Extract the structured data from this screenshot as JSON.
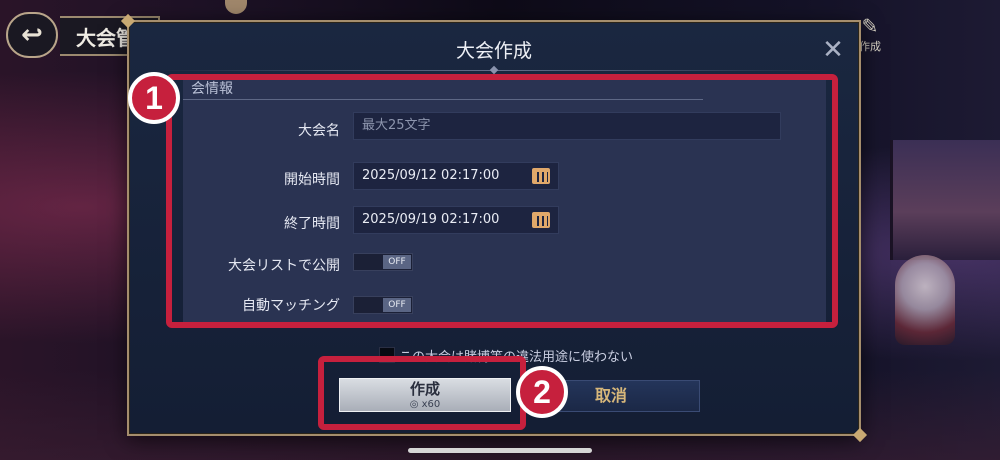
{
  "header": {
    "back_icon": "back-arrow-icon",
    "title": "大会管",
    "create_icon": "create-icon",
    "create_label": "作成"
  },
  "modal": {
    "title": "大会作成",
    "close_icon": "close-icon",
    "section_label": "会情報",
    "fields": {
      "name": {
        "label": "大会名",
        "placeholder": "最大25文字"
      },
      "start": {
        "label": "開始時間",
        "value": "2025/09/12 02:17:00",
        "icon": "calendar-icon"
      },
      "end": {
        "label": "終了時間",
        "value": "2025/09/19 02:17:00",
        "icon": "calendar-icon"
      },
      "public_list": {
        "label": "大会リストで公開",
        "state": "OFF"
      },
      "auto_match": {
        "label": "自動マッチング",
        "state": "OFF"
      }
    },
    "disclaimer": "この大会は賭博等の違法用途に使わない",
    "buttons": {
      "create": {
        "label": "作成",
        "cost": "x60",
        "cost_icon": "currency-icon"
      },
      "cancel": {
        "label": "取消"
      }
    }
  },
  "annotations": {
    "badge_1": "1",
    "badge_2": "2",
    "highlight_color": "#c6203d"
  }
}
